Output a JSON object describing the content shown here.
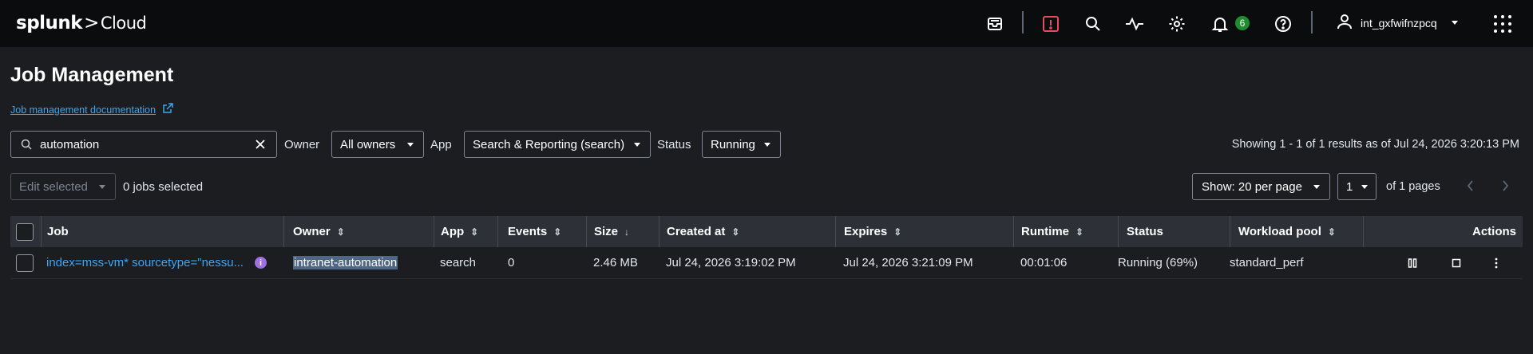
{
  "topbar": {
    "logo_main": "splunk",
    "logo_sep": ">",
    "logo_product": "Cloud",
    "icons": [
      "inbox-icon",
      "alert-icon",
      "search-icon",
      "activity-icon",
      "gear-icon",
      "bell-icon",
      "help-icon"
    ],
    "notification_count": "6",
    "username": "int_gxfwifnzpcq"
  },
  "page": {
    "title": "Job Management",
    "doc_link": "Job management documentation"
  },
  "filters": {
    "search_value": "automation",
    "owner_label": "Owner",
    "owner_value": "All owners",
    "app_label": "App",
    "app_value": "Search & Reporting (search)",
    "status_label": "Status",
    "status_value": "Running",
    "showing": "Showing 1 - 1 of 1 results as of Jul 24, 2026 3:20:13 PM"
  },
  "bulk": {
    "edit_selected": "Edit selected",
    "jobs_selected": "0 jobs selected",
    "per_page": "Show: 20 per page",
    "page": "1",
    "of_pages": "of 1 pages"
  },
  "table": {
    "headers": {
      "job": "Job",
      "owner": "Owner",
      "app": "App",
      "events": "Events",
      "size": "Size",
      "created": "Created at",
      "expires": "Expires",
      "runtime": "Runtime",
      "status": "Status",
      "pool": "Workload pool",
      "actions": "Actions"
    },
    "rows": [
      {
        "job": "index=mss-vm* sourcetype=\"nessu...",
        "owner": "intranet-automation",
        "app": "search",
        "events": "0",
        "size": "2.46 MB",
        "created": "Jul 24, 2026 3:19:02 PM",
        "expires": "Jul 24, 2026 3:21:09 PM",
        "runtime": "00:01:06",
        "status": "Running (69%)",
        "pool": "standard_perf"
      }
    ]
  },
  "colors": {
    "accent": "#3ba6f4",
    "badge": "#1e8c2f",
    "alert": "#e84b5c",
    "info": "#a070e0"
  }
}
